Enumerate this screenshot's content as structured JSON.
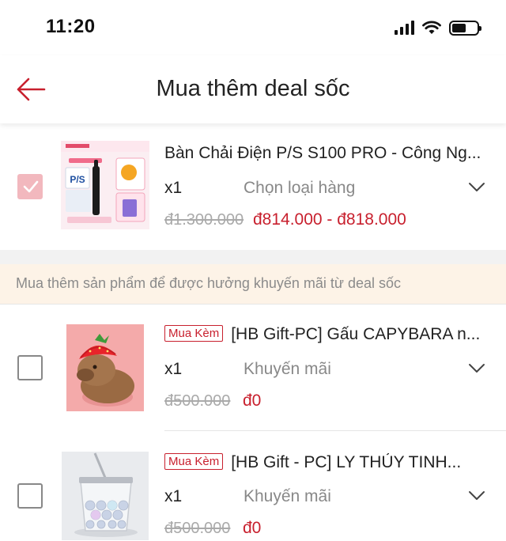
{
  "status_bar": {
    "time": "11:20"
  },
  "header": {
    "title": "Mua thêm deal sốc"
  },
  "main_product": {
    "selected": true,
    "name": "Bàn Chải Điện P/S S100 PRO - Công Ng...",
    "quantity": "x1",
    "variant_placeholder": "Chọn loại hàng",
    "original_price": "đ1.300.000",
    "price_range": "đ814.000 - đ818.000",
    "thumb_text": "P/S"
  },
  "notice": {
    "text": "Mua thêm sản phẩm để được hưởng khuyến mãi từ deal sốc"
  },
  "addons": [
    {
      "selected": false,
      "badge": "Mua Kèm",
      "name": "[HB Gift-PC] Gấu CAPYBARA n...",
      "quantity": "x1",
      "variant": "Khuyến mãi",
      "original_price": "đ500.000",
      "price": "đ0"
    },
    {
      "selected": false,
      "badge": "Mua Kèm",
      "name": "[HB Gift - PC] LY THỦY TINH...",
      "quantity": "x1",
      "variant": "Khuyến mãi",
      "original_price": "đ500.000",
      "price": "đ0"
    }
  ],
  "colors": {
    "accent": "#c8202e",
    "checked_fill": "#f2b8be",
    "notice_bg": "#fdf3e7"
  }
}
